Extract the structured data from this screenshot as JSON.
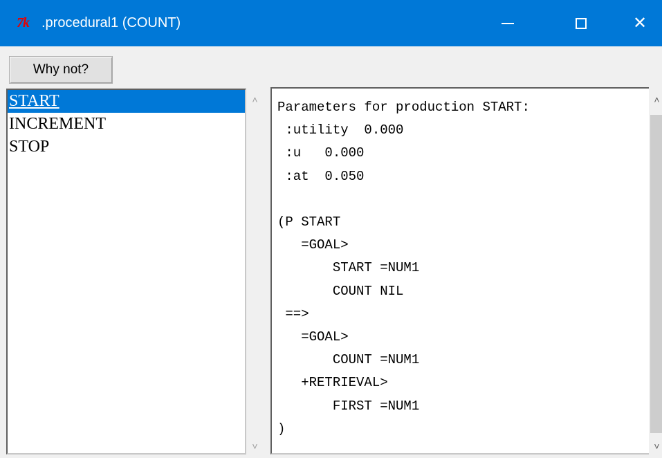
{
  "window": {
    "logo_text": "7k",
    "title": ".procedural1 (COUNT)",
    "controls": {
      "minimize_icon": "minimize-icon",
      "maximize_icon": "maximize-icon",
      "close_icon": "close-icon",
      "close_glyph": "✕"
    }
  },
  "toolbar": {
    "why_not_label": "Why not?"
  },
  "productions": {
    "items": [
      "START",
      "INCREMENT",
      "STOP"
    ],
    "selected": "START"
  },
  "scrollbars": {
    "up_glyph": "˄",
    "down_glyph": "˅"
  },
  "details": {
    "lines": [
      "Parameters for production START:",
      " :utility  0.000",
      " :u   0.000",
      " :at  0.050",
      "",
      "(P START",
      "   =GOAL>",
      "       START =NUM1",
      "       COUNT NIL",
      " ==>",
      "   =GOAL>",
      "       COUNT =NUM1",
      "   +RETRIEVAL>",
      "       FIRST =NUM1",
      ")"
    ]
  },
  "colors": {
    "titlebar": "#0078d7",
    "selection": "#0078d7",
    "logo": "#e60000"
  }
}
